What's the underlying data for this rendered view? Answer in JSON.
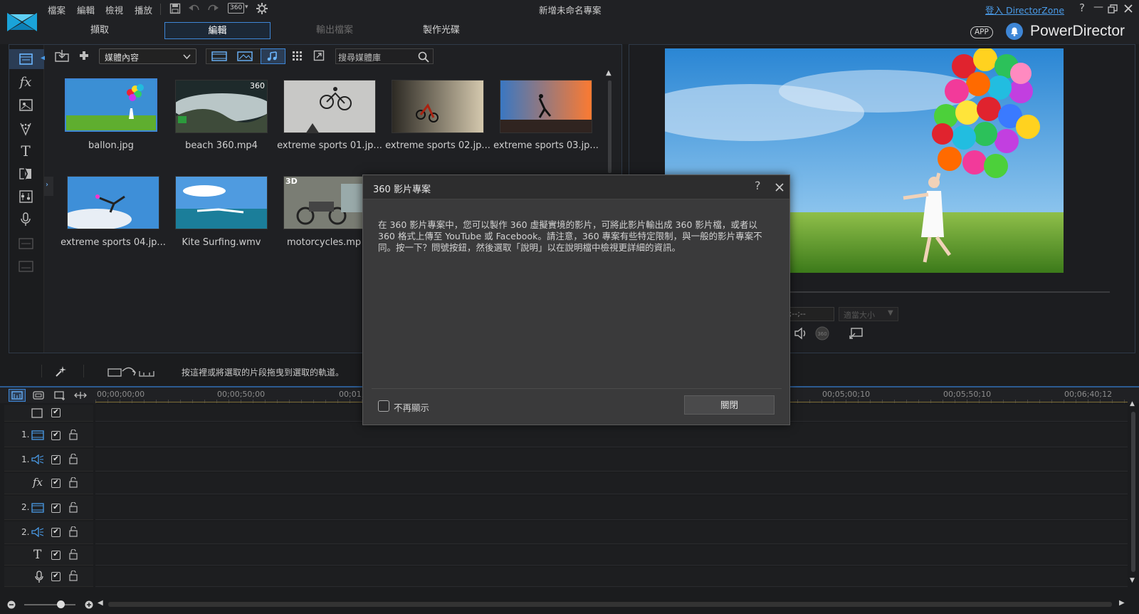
{
  "menu": [
    "檔案",
    "編輯",
    "檢視",
    "播放"
  ],
  "toolbar": {
    "icon_360_label": "360",
    "project_title": "新增未命名專案",
    "login_link": "登入 DirectorZone"
  },
  "modes": [
    {
      "label": "擷取",
      "state": "normal"
    },
    {
      "label": "編輯",
      "state": "active"
    },
    {
      "label": "輸出檔案",
      "state": "disabled"
    },
    {
      "label": "製作光碟",
      "state": "normal"
    }
  ],
  "brand": {
    "app_badge": "APP",
    "name": "PowerDirector",
    "accent": "#3e86d6"
  },
  "library": {
    "dropdown_label": "媒體內容",
    "search_placeholder": "搜尋媒體庫",
    "items": [
      {
        "name": "ballon.jpg",
        "thumb": "balloon",
        "badge": ""
      },
      {
        "name": "beach 360.mp4",
        "thumb": "beach",
        "badge": "360"
      },
      {
        "name": "extreme sports 01.jp...",
        "thumb": "bike",
        "badge": ""
      },
      {
        "name": "extreme sports 02.jp...",
        "thumb": "moto",
        "badge": ""
      },
      {
        "name": "extreme sports 03.jp...",
        "thumb": "skate",
        "badge": ""
      },
      {
        "name": "extreme sports 04.jp...",
        "thumb": "sky",
        "badge": ""
      },
      {
        "name": "Kite Surfing.wmv",
        "thumb": "kite",
        "badge": ""
      },
      {
        "name": "motorcycles.mp",
        "thumb": "motorcycles",
        "badge": "3D"
      }
    ]
  },
  "preview": {
    "timecode": "--;--;--;--",
    "fit_label": "適當大小"
  },
  "dialog": {
    "title": "360 影片專案",
    "body": "在 360 影片專案中，您可以製作 360 虛擬實境的影片，可將此影片輸出成 360 影片檔，或者以 360 格式上傳至 YouTube 或 Facebook。請注意，360 專案有些特定限制，與一般的影片專案不同。按一下？問號按鈕，然後選取「說明」以在說明檔中檢視更詳細的資訊。",
    "dont_show": "不再顯示",
    "close_button": "關閉"
  },
  "timeline": {
    "hint": "按這裡或將選取的片段拖曳到選取的軌道。",
    "ruler_ticks": [
      "00;00;00;00",
      "00;00;50;00",
      "00;01;",
      "00;05;00;10",
      "00;05;50;10",
      "00;06;40;12"
    ],
    "tracks": [
      {
        "num": "",
        "icon": "video-track"
      },
      {
        "num": "1.",
        "icon": "video-track"
      },
      {
        "num": "1.",
        "icon": "audio-track"
      },
      {
        "num": "",
        "icon": "fx-track"
      },
      {
        "num": "2.",
        "icon": "video-track"
      },
      {
        "num": "2.",
        "icon": "audio-track"
      },
      {
        "num": "",
        "icon": "title-track"
      },
      {
        "num": "",
        "icon": "voice-track"
      }
    ]
  }
}
